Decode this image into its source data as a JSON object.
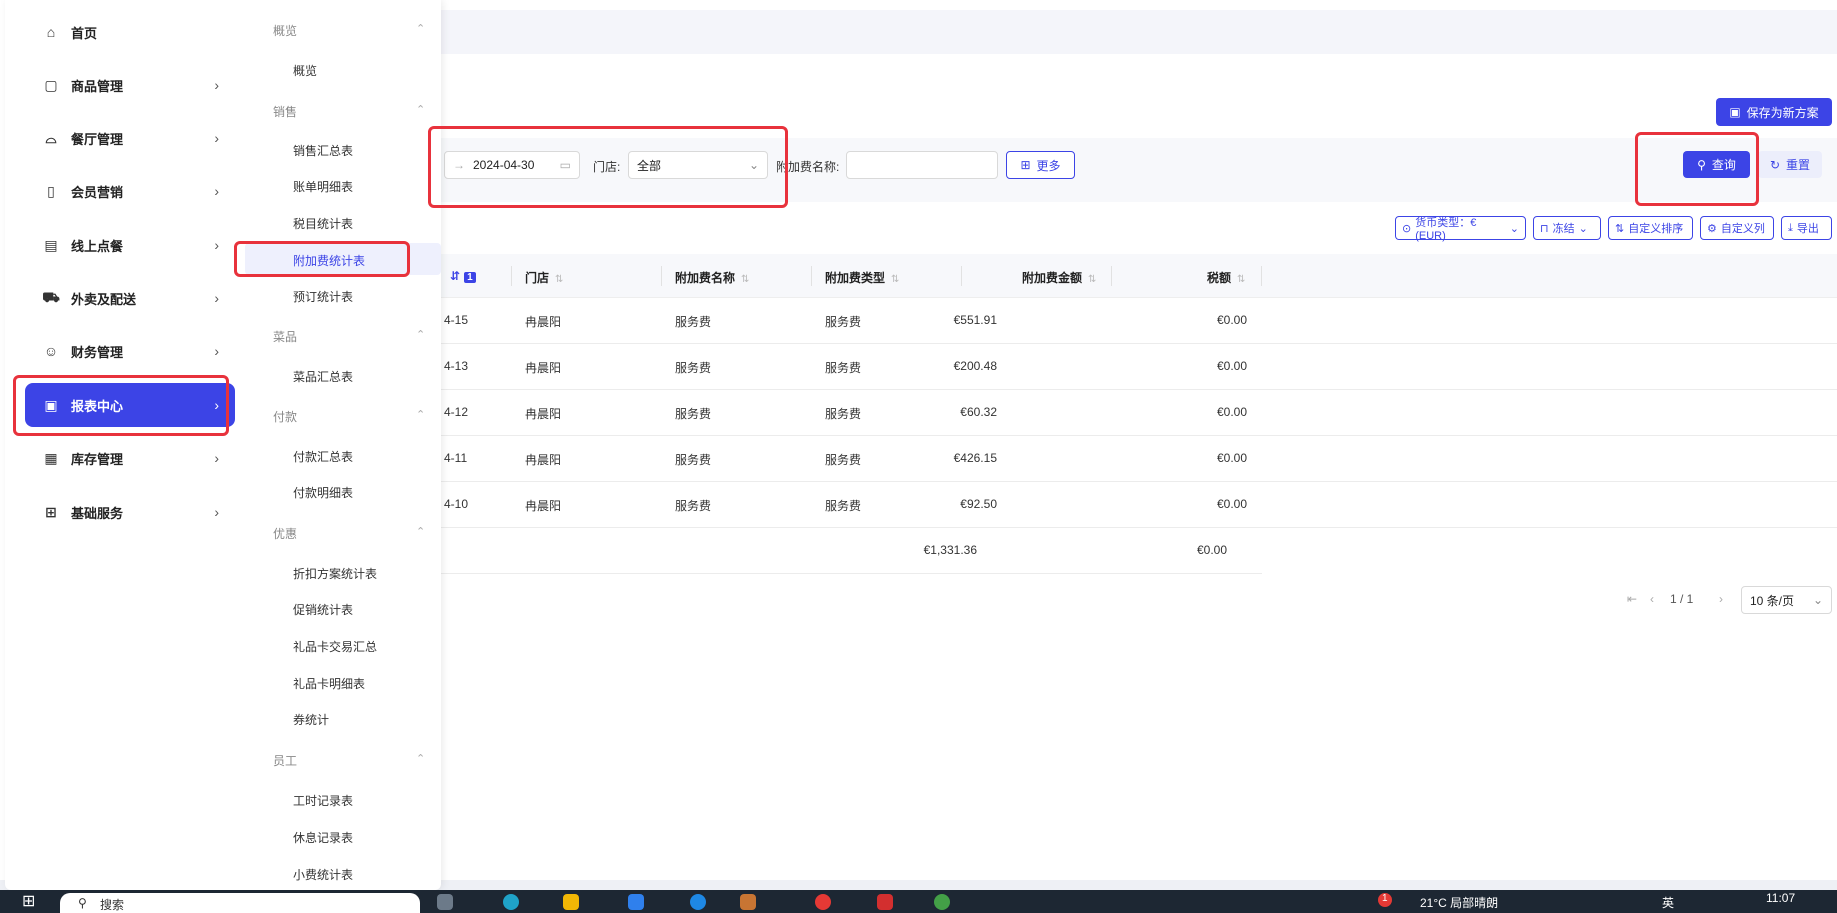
{
  "header": {
    "save_scheme_label": "保存为新方案"
  },
  "filters": {
    "date_end": "2024-04-30",
    "store_label": "门店:",
    "store_value": "全部",
    "surcharge_name_label": "附加费名称:",
    "surcharge_name_value": "",
    "more_label": "更多",
    "query_label": "查询",
    "reset_label": "重置"
  },
  "table_toolbar": {
    "currency_label": "货币类型：€(EUR)",
    "freeze_label": "冻结",
    "custom_sort_label": "自定义排序",
    "custom_columns_label": "自定义列",
    "export_label": "导出"
  },
  "table": {
    "sort_badge": "1",
    "columns": [
      "门店",
      "附加费名称",
      "附加费类型",
      "附加费金额",
      "税额"
    ],
    "rows": [
      {
        "date": "4-15",
        "store": "冉晨阳",
        "name": "服务费",
        "type": "服务费",
        "amount": "€551.91",
        "tax": "€0.00"
      },
      {
        "date": "4-13",
        "store": "冉晨阳",
        "name": "服务费",
        "type": "服务费",
        "amount": "€200.48",
        "tax": "€0.00"
      },
      {
        "date": "4-12",
        "store": "冉晨阳",
        "name": "服务费",
        "type": "服务费",
        "amount": "€60.32",
        "tax": "€0.00"
      },
      {
        "date": "4-11",
        "store": "冉晨阳",
        "name": "服务费",
        "type": "服务费",
        "amount": "€426.15",
        "tax": "€0.00"
      },
      {
        "date": "4-10",
        "store": "冉晨阳",
        "name": "服务费",
        "type": "服务费",
        "amount": "€92.50",
        "tax": "€0.00"
      }
    ],
    "total": {
      "amount": "€1,331.36",
      "tax": "€0.00"
    }
  },
  "pagination": {
    "current": "1 / 1",
    "page_size": "10 条/页"
  },
  "sidebar": {
    "items": [
      {
        "label": "首页",
        "icon": "home-icon"
      },
      {
        "label": "商品管理",
        "icon": "product-icon"
      },
      {
        "label": "餐厅管理",
        "icon": "restaurant-icon"
      },
      {
        "label": "会员营销",
        "icon": "member-icon"
      },
      {
        "label": "线上点餐",
        "icon": "online-order-icon"
      },
      {
        "label": "外卖及配送",
        "icon": "delivery-icon"
      },
      {
        "label": "财务管理",
        "icon": "finance-icon"
      },
      {
        "label": "报表中心",
        "icon": "report-icon"
      },
      {
        "label": "库存管理",
        "icon": "inventory-icon"
      },
      {
        "label": "基础服务",
        "icon": "grid-icon"
      }
    ]
  },
  "submenu": {
    "groups": [
      {
        "title": "概览",
        "items": [
          "概览"
        ]
      },
      {
        "title": "销售",
        "items": [
          "销售汇总表",
          "账单明细表",
          "税目统计表",
          "附加费统计表",
          "预订统计表"
        ]
      },
      {
        "title": "菜品",
        "items": [
          "菜品汇总表"
        ]
      },
      {
        "title": "付款",
        "items": [
          "付款汇总表",
          "付款明细表"
        ]
      },
      {
        "title": "优惠",
        "items": [
          "折扣方案统计表",
          "促销统计表",
          "礼品卡交易汇总",
          "礼品卡明细表",
          "券统计"
        ]
      },
      {
        "title": "员工",
        "items": [
          "工时记录表",
          "休息记录表",
          "小费统计表"
        ]
      }
    ]
  },
  "taskbar": {
    "search_text": "搜索",
    "weather_text": "21°C 局部晴朗",
    "lang_text": "英",
    "time_text": "11:07",
    "notification_count": "1"
  },
  "colors": {
    "primary": "#3c44e6",
    "annotation_red": "#e8323c"
  }
}
